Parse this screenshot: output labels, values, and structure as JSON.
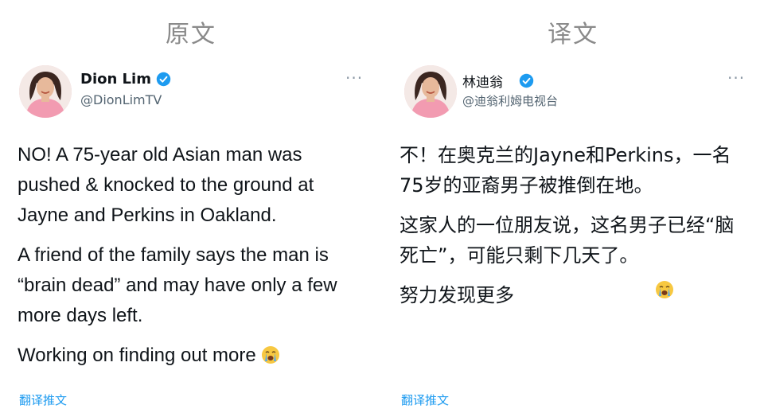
{
  "left": {
    "title": "原文",
    "display_name": "Dion Lim",
    "handle": "@DionLimTV",
    "more": "···",
    "paragraphs": [
      "NO! A 75-year old Asian man was pushed & knocked to the ground at Jayne and Perkins in Oakland.",
      "A friend of the family says the man is “brain dead” and may have only a few more days left."
    ],
    "last_paragraph": "Working on finding out more",
    "translate_label": "翻译推文"
  },
  "right": {
    "title": "译文",
    "display_name": "林迪翁",
    "handle": "@迪翁利姆电视台",
    "more": "···",
    "paragraphs": [
      "不！在奥克兰的Jayne和Perkins，一名75岁的亚裔男子被推倒在地。",
      "这家人的一位朋友说，这名男子已经“脑死亡”，可能只剩下几天了。"
    ],
    "last_paragraph": "努力发现更多",
    "translate_label": "翻译推文"
  },
  "icons": {
    "verified": "verified-badge-icon",
    "emoji": "loudly-crying-face-emoji",
    "more": "more-options-icon"
  },
  "colors": {
    "link": "#1d9bf0",
    "verified": "#1d9bf0",
    "secondary_text": "#536471",
    "title_gray": "#8a8a8a"
  }
}
